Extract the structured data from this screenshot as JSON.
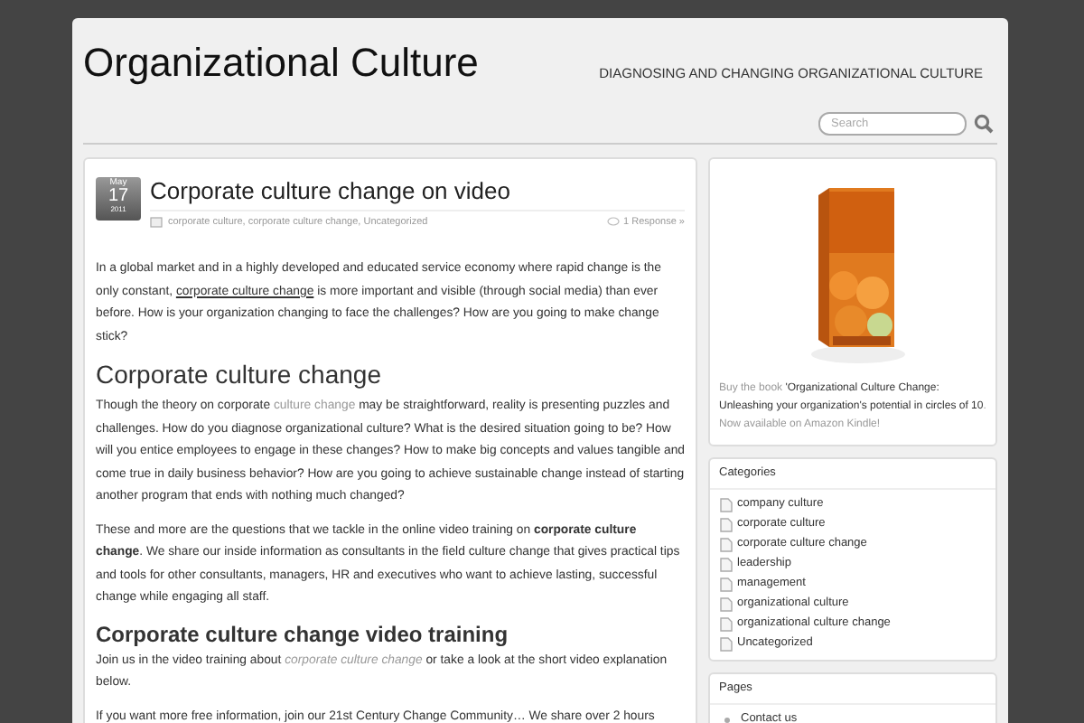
{
  "site": {
    "title": "Organizational Culture",
    "tagline": "DIAGNOSING AND CHANGING ORGANIZATIONAL CULTURE",
    "search": {
      "placeholder": "Search"
    }
  },
  "post": {
    "date": {
      "month": "May",
      "day": "17",
      "year": "2011"
    },
    "title": "Corporate culture change on video",
    "categories": "corporate culture, corporate culture change, Uncategorized",
    "responses": "1 Response »",
    "blocks": [
      {
        "kind": "paragraph",
        "parts": [
          {
            "kind": "text",
            "text": "In a global market and in a highly developed and educated service economy where rapid change is the only constant, "
          },
          {
            "kind": "link",
            "text": "corporate culture change"
          },
          {
            "kind": "text",
            "text": " is more important and visible (through social media) than ever before. How is your organization changing to face the challenges? How are you going to make change stick?"
          }
        ]
      },
      {
        "kind": "heading",
        "text": "Corporate culture change"
      },
      {
        "kind": "paragraph",
        "parts": [
          {
            "kind": "text",
            "text": "Though the theory on corporate "
          },
          {
            "kind": "muted-link",
            "text": "culture change"
          },
          {
            "kind": "text",
            "text": " may be straightforward, reality is presenting puzzles and challenges. How do you diagnose organizational culture? What is the desired situation going to be? How will you entice employees to engage in these changes? How to make big concepts and values tangible and come true in daily business behavior? How are you going to achieve sustainable change instead of starting another program that ends with nothing much changed?"
          }
        ]
      },
      {
        "kind": "paragraph",
        "parts": [
          {
            "kind": "text",
            "text": "These and more are the questions that we tackle in the online video training on **corporate culture change**. We share our inside information as consultants in the field culture change that gives practical tips and tools for other consultants, managers, HR and executives who want to achieve lasting, successful change while engaging all staff."
          }
        ]
      },
      {
        "kind": "subheading",
        "text": "Corporate culture change video training"
      },
      {
        "kind": "paragraph",
        "parts": [
          {
            "kind": "text",
            "text": "Join us in the video training about "
          },
          {
            "kind": "italic-link",
            "text": "corporate culture change"
          },
          {
            "kind": "text",
            "text": " or take a look at the short video explanation below."
          }
        ]
      },
      {
        "kind": "paragraph",
        "parts": [
          {
            "kind": "text",
            "text": "If you want more free information, join our 21st Century Change Community… We share over 2 hours"
          }
        ]
      }
    ]
  },
  "sidebar": {
    "book": {
      "parts": [
        {
          "kind": "muted",
          "text": "Buy the book "
        },
        {
          "kind": "dark",
          "text": "'Organizational Culture Change: Unleashing your organization's potential in circles of 10"
        },
        {
          "kind": "muted",
          "text": ". Now available on Amazon Kindle!"
        }
      ]
    },
    "categories": {
      "title": "Categories",
      "items": [
        "company culture",
        "corporate culture",
        "corporate culture change",
        "leadership",
        "management",
        "organizational culture",
        "organizational culture change",
        "Uncategorized"
      ]
    },
    "pages": {
      "title": "Pages",
      "items": [
        "Contact us"
      ]
    }
  }
}
